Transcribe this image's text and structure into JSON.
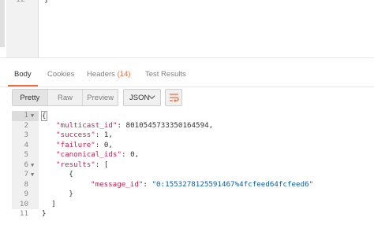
{
  "request_editor": {
    "line_number": "12",
    "code": "}"
  },
  "tabs": [
    {
      "label": "Body",
      "active": true
    },
    {
      "label": "Cookies",
      "active": false
    },
    {
      "label": "Headers",
      "count": "(14)",
      "active": false
    },
    {
      "label": "Test Results",
      "active": false
    }
  ],
  "toolbar": {
    "view_modes": [
      "Pretty",
      "Raw",
      "Preview"
    ],
    "format_select": "JSON",
    "wrap_icon": "wrap-lines-icon"
  },
  "response": {
    "lines": [
      {
        "n": "1",
        "fold": "▼",
        "text": "{"
      },
      {
        "n": "2",
        "fold": "",
        "key": "\"multicast_id\"",
        "value": " 8010545733350164594,"
      },
      {
        "n": "3",
        "fold": "",
        "key": "\"success\"",
        "value": " 1,"
      },
      {
        "n": "4",
        "fold": "",
        "key": "\"failure\"",
        "value": " 0,"
      },
      {
        "n": "5",
        "fold": "",
        "key": "\"canonical_ids\"",
        "value": " 0,"
      },
      {
        "n": "6",
        "fold": "▼",
        "key": "\"results\"",
        "value": " ["
      },
      {
        "n": "7",
        "fold": "▼",
        "text": "        {"
      },
      {
        "n": "8",
        "fold": "",
        "key": "\"message_id\"",
        "string": "\"0:1553278125591467%4fcfeed64fcfeed6\""
      },
      {
        "n": "9",
        "fold": "",
        "text": "        }"
      },
      {
        "n": "10",
        "fold": "",
        "text": "    ]"
      },
      {
        "n": "11",
        "fold": "",
        "text": "}"
      }
    ]
  },
  "colors": {
    "accent": "#f26b3a",
    "key": "#c7254e",
    "string": "#0b5ea8"
  }
}
